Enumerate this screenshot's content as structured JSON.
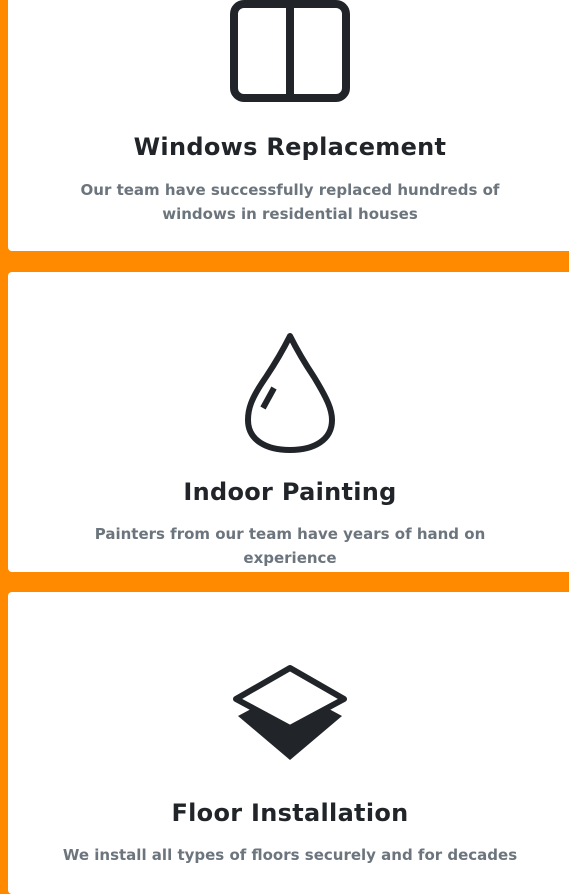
{
  "colors": {
    "background": "#ff8a00",
    "card": "#ffffff",
    "title": "#212529",
    "text": "#6c757d",
    "icon": "#212529"
  },
  "services": [
    {
      "icon": "window-icon",
      "title": "Windows Replacement",
      "description": "Our team have successfully replaced hundreds of windows in residential houses"
    },
    {
      "icon": "drop-icon",
      "title": "Indoor Painting",
      "description": "Painters from our team have years of hand on experience"
    },
    {
      "icon": "layers-icon",
      "title": "Floor Installation",
      "description": "We install all types of floors securely and for decades"
    }
  ]
}
